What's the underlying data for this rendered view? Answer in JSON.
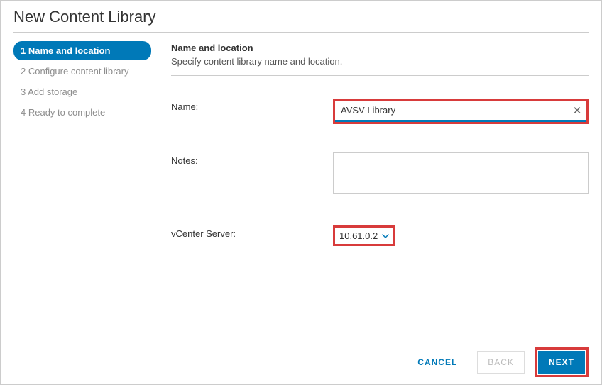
{
  "dialog": {
    "title": "New Content Library"
  },
  "steps": [
    {
      "label": "1 Name and location",
      "active": true
    },
    {
      "label": "2 Configure content library",
      "active": false
    },
    {
      "label": "3 Add storage",
      "active": false
    },
    {
      "label": "4 Ready to complete",
      "active": false
    }
  ],
  "section": {
    "title": "Name and location",
    "subtitle": "Specify content library name and location."
  },
  "form": {
    "name_label": "Name:",
    "name_value": "AVSV-Library",
    "notes_label": "Notes:",
    "notes_value": "",
    "server_label": "vCenter Server:",
    "server_value": "10.61.0.2"
  },
  "footer": {
    "cancel": "CANCEL",
    "back": "BACK",
    "next": "NEXT"
  }
}
